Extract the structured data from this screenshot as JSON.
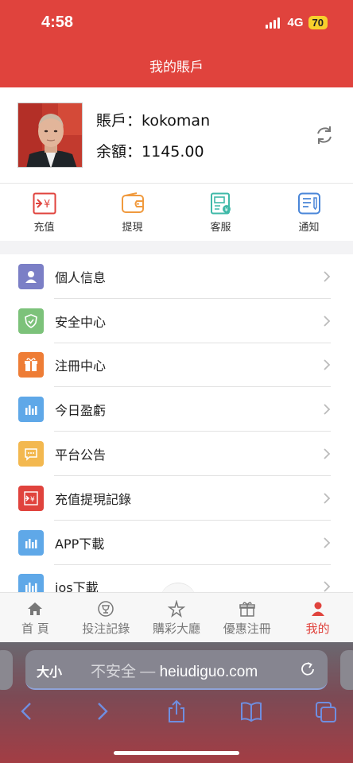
{
  "status_bar": {
    "time": "4:58",
    "network": "4G",
    "battery": "70"
  },
  "header": {
    "title": "我的賬戶"
  },
  "account": {
    "username_label": "賬戶：",
    "username": "kokoman",
    "balance_label": "余額：",
    "balance": "1145.00"
  },
  "quick_actions": [
    {
      "label": "充值",
      "icon": "recharge-icon",
      "color": "#e0433d"
    },
    {
      "label": "提現",
      "icon": "wallet-icon",
      "color": "#f09a3e"
    },
    {
      "label": "客服",
      "icon": "service-icon",
      "color": "#3fb9a8"
    },
    {
      "label": "通知",
      "icon": "notice-icon",
      "color": "#4a86d8"
    }
  ],
  "menu": [
    {
      "label": "個人信息",
      "icon": "user-icon",
      "color": "#7b7fc6"
    },
    {
      "label": "安全中心",
      "icon": "shield-icon",
      "color": "#7cc27a"
    },
    {
      "label": "注冊中心",
      "icon": "gift-icon",
      "color": "#ee7d36"
    },
    {
      "label": "今日盈虧",
      "icon": "bar-chart-icon",
      "color": "#5fa8e8"
    },
    {
      "label": "平台公告",
      "icon": "message-icon",
      "color": "#f3b84f"
    },
    {
      "label": "充值提現記錄",
      "icon": "recharge-record-icon",
      "color": "#e0433d"
    },
    {
      "label": "APP下載",
      "icon": "bar-chart-icon",
      "color": "#5fa8e8"
    },
    {
      "label": "ios下載",
      "icon": "bar-chart-icon",
      "color": "#5fa8e8"
    }
  ],
  "tabs": [
    {
      "label": "首 頁",
      "icon": "home-icon",
      "active": false
    },
    {
      "label": "投注記錄",
      "icon": "trophy-icon",
      "active": false
    },
    {
      "label": "購彩大廳",
      "icon": "star-icon",
      "active": false
    },
    {
      "label": "優惠注冊",
      "icon": "gift-icon",
      "active": false
    },
    {
      "label": "我的",
      "icon": "user-icon",
      "active": true
    }
  ],
  "browser": {
    "text_size_label": "大小",
    "insecure_label": "不安全 — ",
    "domain": "heiudiguo.com"
  },
  "colors": {
    "primary": "#e0433d",
    "inactive": "#777777"
  }
}
